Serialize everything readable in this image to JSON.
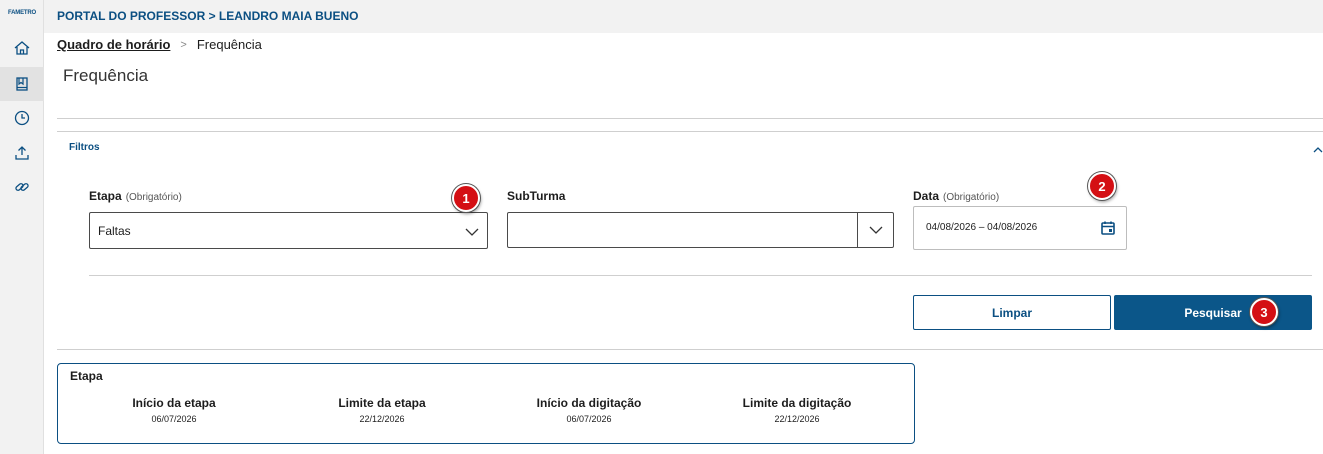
{
  "sidebar": {
    "logo_text": "FAMETRO",
    "items": [
      {
        "icon": "home-icon"
      },
      {
        "icon": "book-icon"
      },
      {
        "icon": "clock-icon"
      },
      {
        "icon": "upload-icon"
      },
      {
        "icon": "link-icon"
      }
    ]
  },
  "topbar": {
    "title": "PORTAL DO PROFESSOR > LEANDRO MAIA BUENO"
  },
  "breadcrumb": {
    "parent": "Quadro de horário",
    "separator": ">",
    "current": "Frequência"
  },
  "page": {
    "title": "Frequência"
  },
  "filters": {
    "section_label": "Filtros",
    "etapa": {
      "label": "Etapa",
      "hint": "(Obrigatório)",
      "value": "Faltas"
    },
    "subturma": {
      "label": "SubTurma",
      "value": ""
    },
    "data": {
      "label": "Data",
      "hint": "(Obrigatório)",
      "value": "04/08/2026  –  04/08/2026"
    },
    "clear_label": "Limpar",
    "search_label": "Pesquisar"
  },
  "badges": {
    "one": "1",
    "two": "2",
    "three": "3"
  },
  "etapa_card": {
    "title": "Etapa",
    "columns": [
      {
        "label": "Início da etapa",
        "value": "06/07/2026"
      },
      {
        "label": "Limite da etapa",
        "value": "22/12/2026"
      },
      {
        "label": "Início da digitação",
        "value": "06/07/2026"
      },
      {
        "label": "Limite da digitação",
        "value": "22/12/2026"
      }
    ]
  },
  "colors": {
    "brand": "#0b4f82",
    "badge": "#d40f14"
  }
}
